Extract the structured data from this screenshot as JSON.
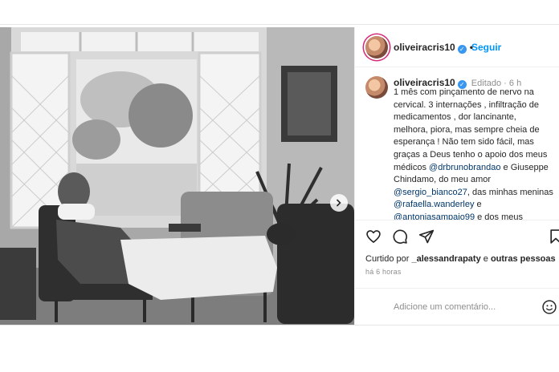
{
  "post": {
    "username": "oliveiracris10",
    "follow_label": "Seguir",
    "caption": {
      "username": "oliveiracris10",
      "edited": "Editado",
      "separator": "·",
      "time": "6 h",
      "lines": [
        {
          "parts": [
            {
              "t": "1 mês com pinçamento de nervo na"
            }
          ]
        },
        {
          "parts": [
            {
              "t": "cervical. 3 internações , infiltração de"
            }
          ]
        },
        {
          "parts": [
            {
              "t": "medicamentos , dor lancinante,"
            }
          ]
        },
        {
          "parts": [
            {
              "t": "melhora, piora, mas sempre cheia de"
            }
          ]
        },
        {
          "parts": [
            {
              "t": "esperança ! Não tem sido fácil, mas"
            }
          ]
        },
        {
          "parts": [
            {
              "t": "graças a Deus tenho o apoio dos meus"
            }
          ]
        },
        {
          "parts": [
            {
              "t": "médicos "
            },
            {
              "t": "@drbrunobrandao",
              "mention": true
            },
            {
              "t": " e Giuseppe"
            }
          ]
        },
        {
          "parts": [
            {
              "t": "Chindamo, do meu amor"
            }
          ]
        },
        {
          "parts": [
            {
              "t": "@sergio_bianco27",
              "mention": true
            },
            {
              "t": ", das minhas meninas"
            }
          ]
        },
        {
          "parts": [
            {
              "t": "@rafaella.wanderley",
              "mention": true
            },
            {
              "t": " e"
            }
          ]
        },
        {
          "parts": [
            {
              "t": "@antoniasampaio99",
              "mention": true
            },
            {
              "t": " e dos meus"
            }
          ]
        }
      ]
    },
    "likes": {
      "prefix": "Curtido por ",
      "user": "_alessandrapaty",
      "middle": " e ",
      "others": "outras pessoas"
    },
    "time_ago": "há 6 horas",
    "comment_placeholder": "Adicione um comentário...",
    "icons": {
      "like": "heart-icon",
      "comment": "comment-icon",
      "share": "paper-plane-icon",
      "save": "bookmark-icon",
      "emoji": "smiley-icon",
      "next": "chevron-right-icon",
      "verified": "verified-badge-icon"
    },
    "colors": {
      "link": "#0095f6",
      "mention": "#00376b",
      "verified": "#3897f0",
      "story_ring": "#d62976"
    }
  }
}
